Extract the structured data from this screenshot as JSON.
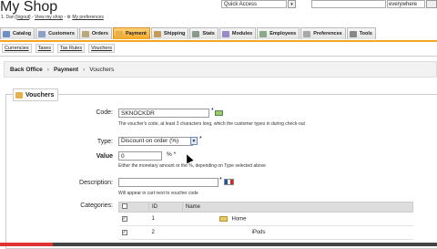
{
  "header": {
    "shop_title": "My Shop",
    "user_bar": {
      "name": "1. Dan",
      "logout": "logout",
      "view_shop": "View my shop",
      "prefs": "My preferences"
    },
    "quick_access": "Quick Access",
    "search_scope": "everywhere"
  },
  "tabs": [
    {
      "label": "Catalog",
      "color": "#6c8fc7"
    },
    {
      "label": "Customers",
      "color": "#8aa0c6"
    },
    {
      "label": "Orders",
      "color": "#b9a87a"
    },
    {
      "label": "Payment",
      "color": "#e8b04a",
      "active": true
    },
    {
      "label": "Shipping",
      "color": "#c79a5a"
    },
    {
      "label": "Stats",
      "color": "#8a9a8a"
    },
    {
      "label": "Modules",
      "color": "#9a8ac8"
    },
    {
      "label": "Employees",
      "color": "#8aa88a"
    },
    {
      "label": "Preferences",
      "color": "#a8a8a8"
    },
    {
      "label": "Tools",
      "color": "#888888"
    }
  ],
  "subtabs": [
    "Currencies",
    "Taxes",
    "Tax Rules",
    "Vouchers"
  ],
  "breadcrumb": {
    "root": "Back Office",
    "section": "Payment",
    "page": "Vouchers"
  },
  "legend": "Vouchers",
  "form": {
    "code": {
      "label": "Code:",
      "value": "SKNOCKDR",
      "help": "The voucher's code, at least 3 characters long, which the customer types in during check-out"
    },
    "type": {
      "label": "Type:",
      "value": "Discount on order (%)"
    },
    "value": {
      "label": "Value",
      "value": "0",
      "unit": "% *",
      "help": "Either the monetary amount or the %, depending on Type selected above"
    },
    "description": {
      "label": "Description:",
      "value": "",
      "help": "Will appear in cart next to voucher code"
    },
    "categories": {
      "label": "Categories:",
      "columns": [
        "",
        "ID",
        "Name"
      ],
      "rows": [
        {
          "id": "1",
          "name": "Home",
          "checked": true
        },
        {
          "id": "2",
          "name": "iPods",
          "checked": true
        }
      ]
    }
  },
  "video_progress": 0.12
}
